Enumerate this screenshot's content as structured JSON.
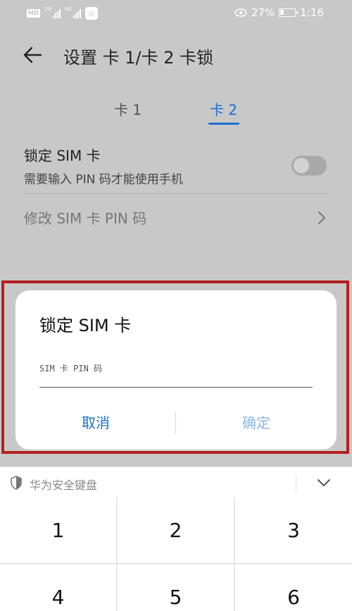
{
  "status_bar": {
    "hd_badge": "HD",
    "net_tag1": "2G",
    "net_tag2": "4G",
    "battery": "27%",
    "time": "1:16"
  },
  "header": {
    "title": "设置 卡 1/卡 2 卡锁"
  },
  "tabs": [
    {
      "label": "卡 1",
      "selected": false
    },
    {
      "label": "卡 2",
      "selected": true
    }
  ],
  "settings": {
    "lock_sim": {
      "title": "锁定 SIM 卡",
      "subtitle": "需要输入 PIN 码才能使用手机",
      "enabled": false
    },
    "change_pin": {
      "title": "修改 SIM 卡 PIN 码"
    }
  },
  "dialog": {
    "title": "锁定 SIM 卡",
    "pin_placeholder": "SIM 卡 PIN 码",
    "cancel": "取消",
    "confirm": "确定"
  },
  "keyboard": {
    "label": "华为安全键盘",
    "keys": [
      "1",
      "2",
      "3",
      "4",
      "5",
      "6"
    ]
  },
  "colors": {
    "accent": "#1a6fd0",
    "highlight_frame": "#b51f1f",
    "overlay": "#c8c8c8"
  }
}
